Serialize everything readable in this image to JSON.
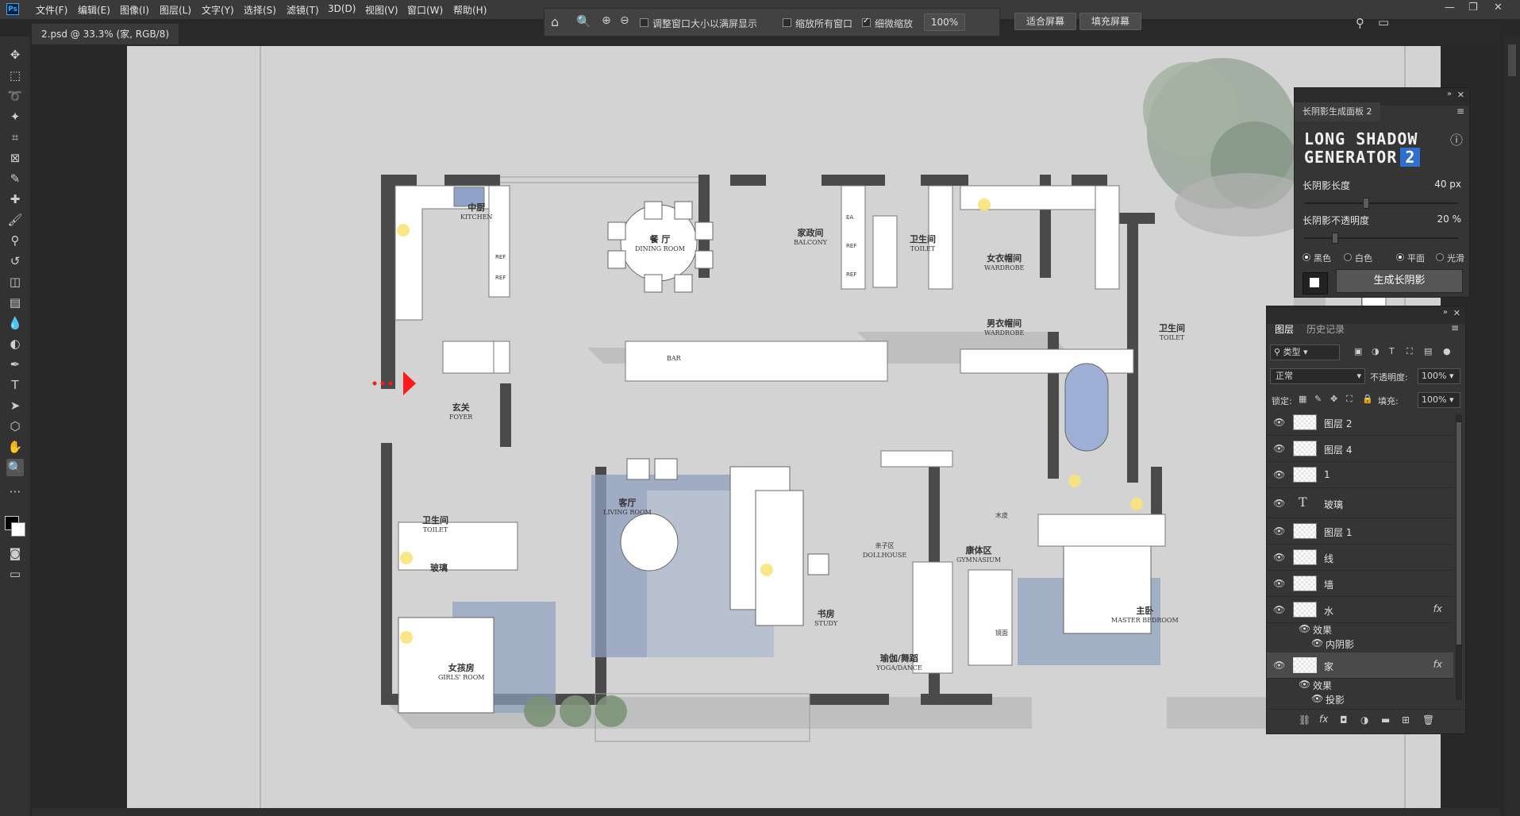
{
  "app": {
    "logo": "Ps"
  },
  "menu": [
    "文件(F)",
    "编辑(E)",
    "图像(I)",
    "图层(L)",
    "文字(Y)",
    "选择(S)",
    "滤镜(T)",
    "3D(D)",
    "视图(V)",
    "窗口(W)",
    "帮助(H)"
  ],
  "options": {
    "check_resize_windows": "调整窗口大小以满屏显示",
    "check_zoom_all": "缩放所有窗口",
    "check_scrubby": "细微缩放",
    "zoom_value": "100%",
    "fit_screen": "适合屏幕",
    "fill_screen": "填充屏幕"
  },
  "document": {
    "tab_title": "2.psd @ 33.3% (家, RGB/8)",
    "close": "×"
  },
  "floorplan": {
    "rooms": [
      {
        "cn": "中厨",
        "en": "KITCHEN"
      },
      {
        "cn": "餐 厅",
        "en": "DINING ROOM"
      },
      {
        "cn": "家政间",
        "en": "BALCONY"
      },
      {
        "cn": "卫生间",
        "en": "TOILET"
      },
      {
        "cn": "女衣帽间",
        "en": "WARDROBE"
      },
      {
        "cn": "男衣帽间",
        "en": "WARDROBE"
      },
      {
        "cn": "卫生间",
        "en": "TOILET"
      },
      {
        "cn": "玄关",
        "en": "FOYER"
      },
      {
        "cn": "",
        "en": "BAR"
      },
      {
        "cn": "客厅",
        "en": "LIVING ROOM"
      },
      {
        "cn": "书房",
        "en": "STUDY"
      },
      {
        "cn": "康体区",
        "en": "GYMNASIUM"
      },
      {
        "cn": "瑜伽/舞蹈",
        "en": "YOGA/DANCE"
      },
      {
        "cn": "主卧",
        "en": "MASTER BEDROOM"
      },
      {
        "cn": "卫生间",
        "en": "TOILET"
      },
      {
        "cn": "女孩房",
        "en": "GIRLS' ROOM"
      },
      {
        "cn": "玻璃",
        "en": ""
      },
      {
        "cn": "亲子区",
        "en": "DOLLHOUSE"
      },
      {
        "cn": "木皮",
        "en": ""
      },
      {
        "cn": "镜面",
        "en": ""
      }
    ],
    "ref_labels": [
      "REF",
      "REF",
      "EA",
      "REF",
      "REF"
    ]
  },
  "long_shadow_panel": {
    "tab": "长阴影生成面板 2",
    "title_line1": "LONG SHADOW",
    "title_line2": "GENERATOR",
    "badge": "2",
    "length_label": "长阴影长度",
    "length_value": "40 px",
    "length_level": 0.4,
    "opacity_label": "长阴影不透明度",
    "opacity_value": "20 %",
    "opacity_level": 0.2,
    "radio_black": "黑色",
    "radio_white": "白色",
    "radio_flat": "平面",
    "radio_smooth": "光滑",
    "generate": "生成长阴影"
  },
  "layers_panel": {
    "tab_layers": "图层",
    "tab_history": "历史记录",
    "filter_kind": "类型",
    "blend_mode": "正常",
    "opacity_label": "不透明度:",
    "opacity_value": "100%",
    "lock_label": "锁定:",
    "fill_label": "填充:",
    "fill_value": "100%",
    "effects_label": "效果",
    "layers": [
      {
        "name": "图层 2"
      },
      {
        "name": "图层 4"
      },
      {
        "name": "1"
      },
      {
        "name": "玻璃",
        "type": "text"
      },
      {
        "name": "图层 1"
      },
      {
        "name": "线"
      },
      {
        "name": "墙"
      },
      {
        "name": "水",
        "fx": "fx",
        "effect": "内阴影"
      },
      {
        "name": "家",
        "fx": "fx",
        "effect": "投影",
        "selected": true
      }
    ]
  }
}
